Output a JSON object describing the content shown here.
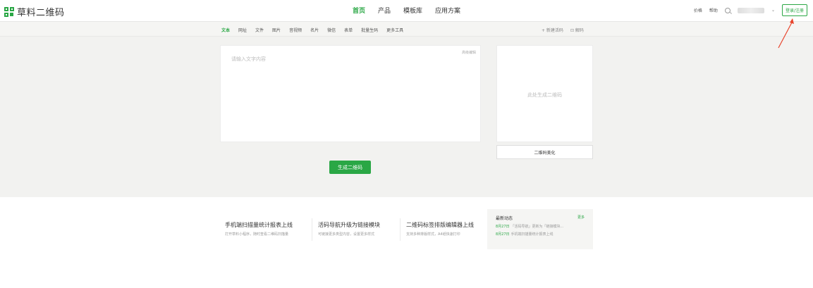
{
  "brand": {
    "name": "草料二维码"
  },
  "main_nav": [
    {
      "label": "首页",
      "active": true
    },
    {
      "label": "产品",
      "active": false
    },
    {
      "label": "模板库",
      "active": false
    },
    {
      "label": "应用方案",
      "active": false
    }
  ],
  "right_bar": {
    "price": "价格",
    "help": "帮助",
    "search_icon": "search-icon",
    "login": "登录/注册"
  },
  "sub_tabs": [
    {
      "label": "文本",
      "active": true
    },
    {
      "label": "网址",
      "active": false
    },
    {
      "label": "文件",
      "active": false
    },
    {
      "label": "图片",
      "active": false
    },
    {
      "label": "音视频",
      "active": false
    },
    {
      "label": "名片",
      "active": false
    },
    {
      "label": "微信",
      "active": false
    },
    {
      "label": "表单",
      "active": false
    },
    {
      "label": "批量生码",
      "active": false
    },
    {
      "label": "更多工具",
      "active": false
    }
  ],
  "sub_right": {
    "new_live_code": "+ 新建活码",
    "decode": "⊡ 解码"
  },
  "editor": {
    "placeholder": "请输入文字内容",
    "advanced_edit": "高级编辑"
  },
  "generate_button": "生成二维码",
  "qr_preview": {
    "placeholder": "此处生成二维码",
    "beautify": "二维码美化"
  },
  "news": [
    {
      "title": "手机端扫描量统计报表上线",
      "desc": "打开草料小程序，随时查看二维码扫描量"
    },
    {
      "title": "活码导航升级为链接模块",
      "desc": "可链接更多类型内容，设置更多样式"
    },
    {
      "title": "二维码标签排版编辑器上线",
      "desc": "支持多种排版样式，A4纸快速打印"
    }
  ],
  "updates": {
    "heading": "最新动态",
    "more": "更多",
    "rows": [
      {
        "date": "8月27日",
        "text": "「活码导航」更新为「链接模块..."
      },
      {
        "date": "8月27日",
        "text": "手机端扫描量统计报表上线"
      }
    ]
  },
  "colors": {
    "accent": "#2aa745",
    "annotation": "#e8442c"
  }
}
